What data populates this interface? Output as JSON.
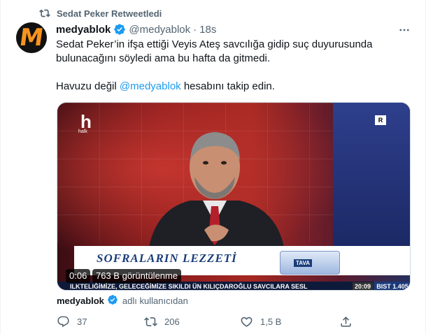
{
  "retweet_context": {
    "label": "Sedat Peker Retweetledi",
    "icon": "retweet-icon"
  },
  "author": {
    "name": "medyablok",
    "handle": "@medyablok",
    "separator": "·",
    "time": "18s",
    "verified": true,
    "avatar_letter": "M"
  },
  "tweet_text": {
    "line1": "Sedat Peker’in ifşa ettiği Veyis Ateş savcılığa gidip suç duyurusunda",
    "line2": "bulunacağını söyledi ama bu hafta da gitmedi.",
    "line3_prefix": "Havuzu değil ",
    "line3_mention": "@medyablok",
    "line3_suffix": " hesabını takip edin."
  },
  "video": {
    "duration": "0:06",
    "views": "763 B görüntülenme",
    "channel_logo": "h",
    "channel_sub": "halk",
    "rating_badge": "R",
    "banner_text": "SOFRALARIN LEZZETİ",
    "product_label": "TAVA",
    "ticker_text": "ILKTELIĞİMİZE, GELECEĞİMİZE SIKILDI ÜN KILIÇDAROĞLU SAVCILARA SESL",
    "ticker_time": "20:09",
    "ticker_bist": "BIST 1.405"
  },
  "credit": {
    "name": "medyablok",
    "rest": "adlı kullanıcıdan"
  },
  "actions": {
    "replies": "37",
    "retweets": "206",
    "likes": "1,5 B"
  },
  "colors": {
    "accent": "#1d9bf0",
    "muted": "#536471",
    "text": "#0f1419"
  }
}
